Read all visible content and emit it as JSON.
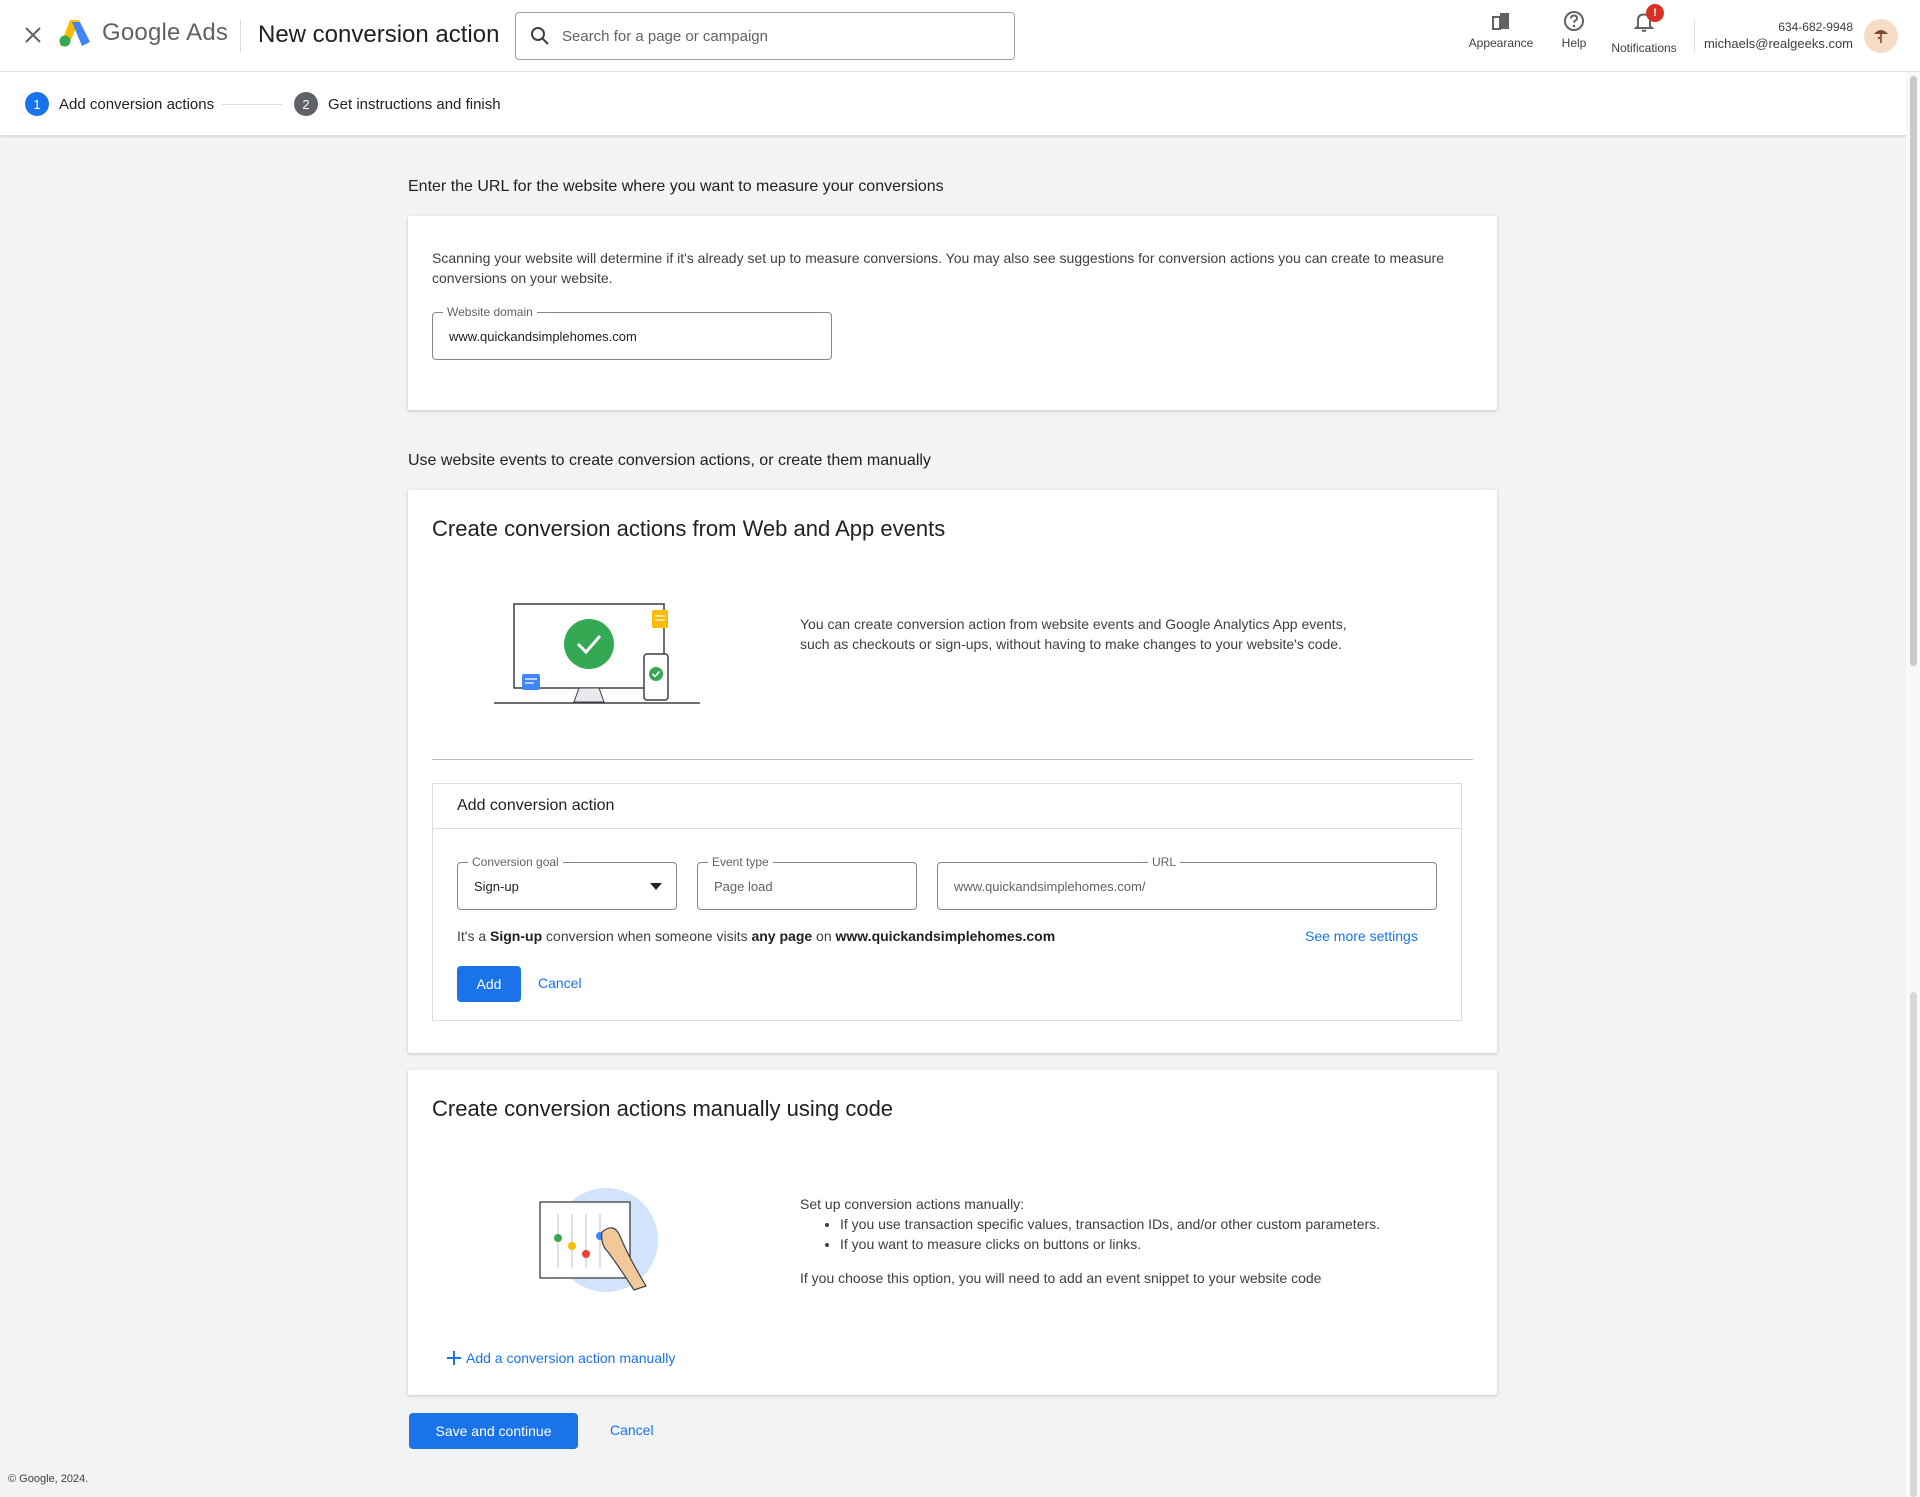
{
  "header": {
    "brand": "Google Ads",
    "brand_google": "Google",
    "brand_ads": "Ads",
    "page_title": "New conversion action",
    "search_placeholder": "Search for a page or campaign",
    "tools": [
      {
        "label": "Appearance",
        "icon": "appearance-icon"
      },
      {
        "label": "Help",
        "icon": "help-icon"
      },
      {
        "label": "Notifications",
        "icon": "bell-icon",
        "badge": "!"
      }
    ],
    "account": {
      "phone": "634-682-9948",
      "email": "michaels@realgeeks.com"
    }
  },
  "stepper": {
    "steps": [
      {
        "num": "1",
        "label": "Add conversion actions",
        "active": true
      },
      {
        "num": "2",
        "label": "Get instructions and finish",
        "active": false
      }
    ]
  },
  "website_section": {
    "heading": "Enter the URL for the website where you want to measure your conversions",
    "description": "Scanning your website will determine if it's already set up to measure conversions. You may also see suggestions for conversion actions you can create to measure conversions on your website.",
    "domain_label": "Website domain",
    "domain_value": "www.quickandsimplehomes.com"
  },
  "events_section": {
    "heading": "Use website events to create conversion actions, or create them manually",
    "card_title": "Create conversion actions from Web and App events",
    "info": "You can create conversion action from website events and Google Analytics App events, such as checkouts or sign-ups, without having to make changes to your website's code.",
    "add_panel": {
      "title": "Add conversion action",
      "goal_label": "Conversion goal",
      "goal_value": "Sign-up",
      "event_label": "Event type",
      "event_placeholder": "Page load",
      "url_label": "URL",
      "url_placeholder": "www.quickandsimplehomes.com/",
      "sentence": {
        "p1": "It's a ",
        "goal": "Sign-up",
        "p2": " conversion when someone visits ",
        "scope": "any page",
        "p3": " on ",
        "domain": "www.quickandsimplehomes.com"
      },
      "see_more": "See more settings",
      "add_label": "Add",
      "cancel_label": "Cancel"
    }
  },
  "manual_section": {
    "card_title": "Create conversion actions manually using code",
    "intro": "Set up conversion actions manually:",
    "bullets": [
      "If you use transaction specific values, transaction IDs, and/or other custom parameters.",
      "If you want to measure clicks on buttons or links."
    ],
    "note": "If you choose this option, you will need to add an event snippet to your website code",
    "add_manual_label": "Add a conversion action manually"
  },
  "actions": {
    "save_label": "Save and continue",
    "cancel_label": "Cancel"
  },
  "footer": {
    "copyright": "© Google, 2024."
  },
  "colors": {
    "primary": "#1a73e8",
    "step_inactive": "#5f6368",
    "badge": "#d93025",
    "success": "#34a853"
  }
}
